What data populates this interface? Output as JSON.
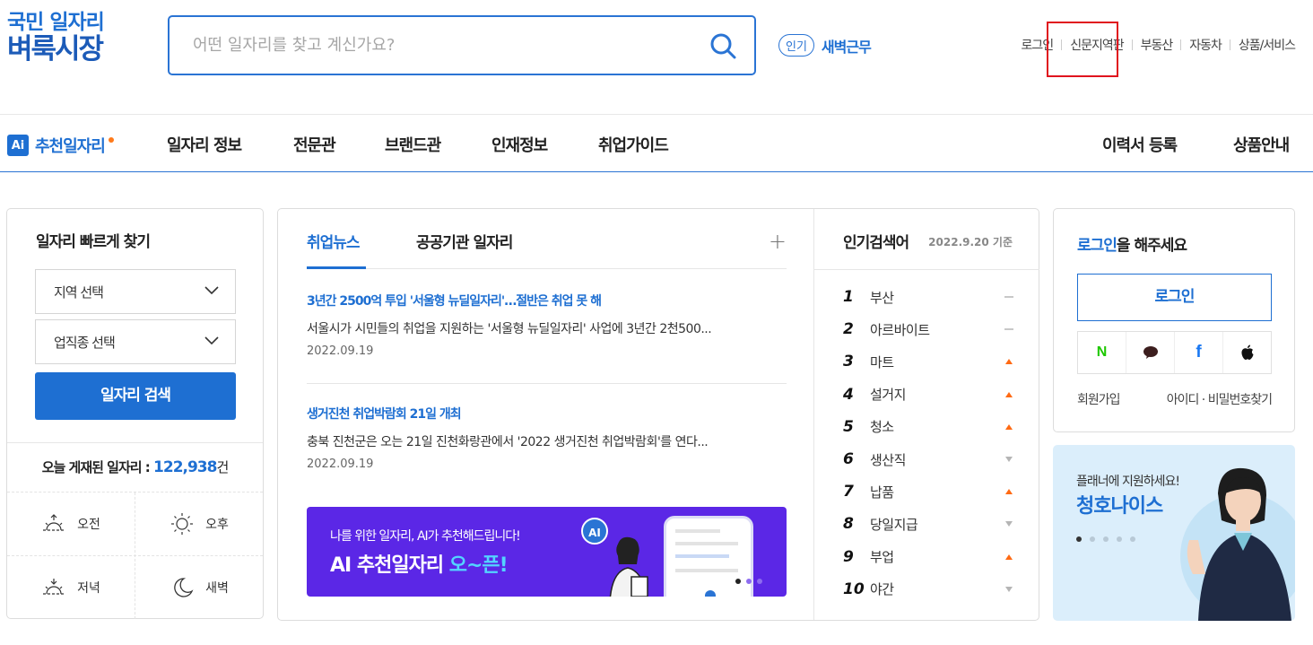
{
  "logo": {
    "line1": "국민 일자리",
    "line2": "벼룩시장"
  },
  "search": {
    "placeholder": "어떤 일자리를 찾고 계신가요?",
    "value": ""
  },
  "popular": {
    "badge": "인기",
    "keyword": "새벽근무"
  },
  "util_links": [
    "로그인",
    "신문지역판",
    "부동산",
    "자동차",
    "상품/서비스"
  ],
  "nav": {
    "ai_badge": "Ai",
    "ai_label": "추천일자리",
    "items": [
      "일자리 정보",
      "전문관",
      "브랜드관",
      "인재정보",
      "취업가이드"
    ],
    "right_items": [
      "이력서 등록",
      "상품안내"
    ]
  },
  "quick_search": {
    "title": "일자리 빠르게 찾기",
    "region_select": "지역 선택",
    "job_select": "업직종 선택",
    "search_button": "일자리 검색",
    "today_label": "오늘 게재된 일자리 :",
    "today_count": "122,938",
    "today_unit": "건",
    "times": [
      "오전",
      "오후",
      "저녁",
      "새벽"
    ]
  },
  "news": {
    "tabs": [
      "취업뉴스",
      "공공기관 일자리"
    ],
    "more": "+",
    "articles": [
      {
        "headline": "3년간 2500억 투입 '서울형 뉴딜일자리'…절반은 취업 못 해",
        "desc": "서울시가 시민들의 취업을 지원하는 '서울형 뉴딜일자리' 사업에 3년간 2천500...",
        "date": "2022.09.19"
      },
      {
        "headline": "생거진천 취업박람회 21일 개최",
        "desc": "충북 진천군은 오는 21일 진천화랑관에서 '2022 생거진천 취업박람회'를 연다...",
        "date": "2022.09.19"
      }
    ],
    "banner": {
      "line1": "나를 위한 일자리, AI가 추천해드립니다!",
      "line2_a": "AI 추천일자리 ",
      "line2_b": "오~픈!",
      "ai_icon": "AI"
    }
  },
  "ranking": {
    "title": "인기검색어",
    "date": "2022.9.20 기준",
    "items": [
      {
        "rank": "1",
        "keyword": "부산",
        "trend": "same"
      },
      {
        "rank": "2",
        "keyword": "아르바이트",
        "trend": "same"
      },
      {
        "rank": "3",
        "keyword": "마트",
        "trend": "up"
      },
      {
        "rank": "4",
        "keyword": "설거지",
        "trend": "up"
      },
      {
        "rank": "5",
        "keyword": "청소",
        "trend": "up"
      },
      {
        "rank": "6",
        "keyword": "생산직",
        "trend": "down"
      },
      {
        "rank": "7",
        "keyword": "납품",
        "trend": "up"
      },
      {
        "rank": "8",
        "keyword": "당일지급",
        "trend": "down"
      },
      {
        "rank": "9",
        "keyword": "부업",
        "trend": "up"
      },
      {
        "rank": "10",
        "keyword": "야간",
        "trend": "down"
      }
    ],
    "colors": {
      "up": "#ff6a13",
      "down": "#b5b5b5",
      "same": "#b5b5b5"
    }
  },
  "login": {
    "title_bold": "로그인",
    "title_rest": "을 해주세요",
    "button": "로그인",
    "social": [
      "naver-icon",
      "kakao-icon",
      "facebook-icon",
      "apple-icon"
    ],
    "naver_glyph": "N",
    "facebook_glyph": "f",
    "links": [
      "회원가입",
      "아이디 · 비밀번호찾기"
    ]
  },
  "ad": {
    "line1": "플래너에 지원하세요!",
    "line2": "청호나이스"
  }
}
